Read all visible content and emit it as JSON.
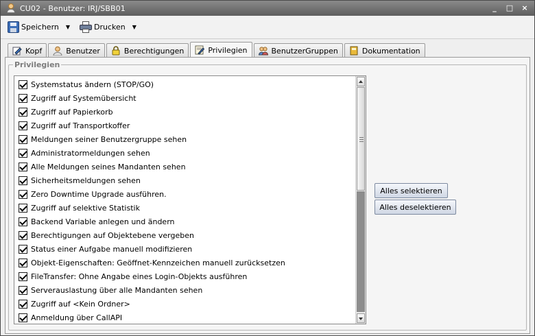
{
  "window": {
    "title": "CU02 - Benutzer: IRJ/SBB01",
    "controls": {
      "minimize": "_",
      "maximize": "□",
      "close": "×"
    }
  },
  "toolbar": {
    "save_label": "Speichern",
    "print_label": "Drucken",
    "dropdown_glyph": "▼"
  },
  "tabs": [
    {
      "label": "Kopf",
      "icon": "edit-icon"
    },
    {
      "label": "Benutzer",
      "icon": "user-icon"
    },
    {
      "label": "Berechtigungen",
      "icon": "lock-icon"
    },
    {
      "label": "Privilegien",
      "icon": "certificate-icon",
      "active": true
    },
    {
      "label": "BenutzerGruppen",
      "icon": "users-group-icon"
    },
    {
      "label": "Dokumentation",
      "icon": "book-icon"
    }
  ],
  "group": {
    "legend": "Privilegien"
  },
  "privileges": [
    {
      "label": "Systemstatus ändern (STOP/GO)",
      "checked": true
    },
    {
      "label": "Zugriff auf Systemübersicht",
      "checked": true
    },
    {
      "label": "Zugriff auf Papierkorb",
      "checked": true
    },
    {
      "label": "Zugriff auf Transportkoffer",
      "checked": true
    },
    {
      "label": "Meldungen seiner Benutzergruppe sehen",
      "checked": true
    },
    {
      "label": "Administratormeldungen sehen",
      "checked": true
    },
    {
      "label": "Alle Meldungen seines Mandanten sehen",
      "checked": true
    },
    {
      "label": "Sicherheitsmeldungen sehen",
      "checked": true
    },
    {
      "label": "Zero Downtime Upgrade ausführen.",
      "checked": true
    },
    {
      "label": "Zugriff auf selektive Statistik",
      "checked": true
    },
    {
      "label": "Backend Variable anlegen und ändern",
      "checked": true
    },
    {
      "label": "Berechtigungen auf Objektebene vergeben",
      "checked": true
    },
    {
      "label": "Status einer Aufgabe manuell modifizieren",
      "checked": true
    },
    {
      "label": "Objekt-Eigenschaften: Geöffnet-Kennzeichen manuell zurücksetzen",
      "checked": true
    },
    {
      "label": "FileTransfer: Ohne Angabe eines Login-Objekts ausführen",
      "checked": true
    },
    {
      "label": "Serverauslastung über alle Mandanten sehen",
      "checked": true
    },
    {
      "label": "Zugriff auf <Kein Ordner>",
      "checked": true
    },
    {
      "label": "Anmeldung über CallAPI",
      "checked": true
    }
  ],
  "buttons": {
    "select_all": "Alles selektieren",
    "deselect_all": "Alles deselektieren"
  }
}
